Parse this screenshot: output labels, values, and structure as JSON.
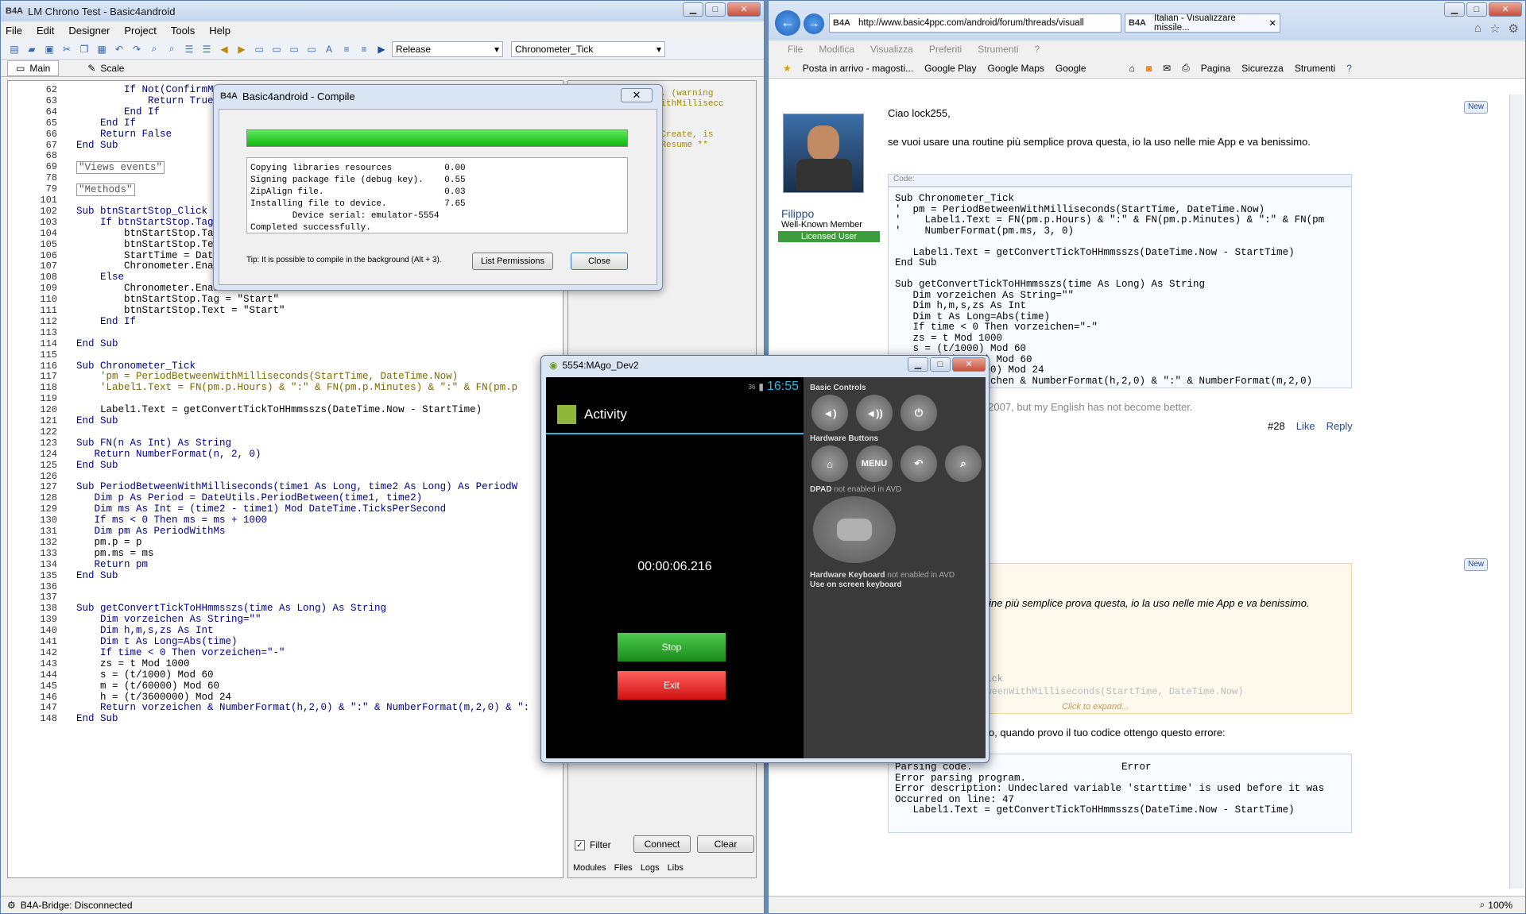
{
  "ide": {
    "title": "LM Chrono Test - Basic4android",
    "menu": [
      "File",
      "Edit",
      "Designer",
      "Project",
      "Tools",
      "Help"
    ],
    "build_config": "Release",
    "sub_selector": "Chronometer_Tick",
    "tabs": [
      "Main",
      "Scale"
    ],
    "status": "B4A-Bridge: Disconnected",
    "lines": [
      {
        "n": "62",
        "t": "        If Not(ConfirmM"
      },
      {
        "n": "63",
        "t": "            Return True"
      },
      {
        "n": "64",
        "t": "        End If"
      },
      {
        "n": "65",
        "t": "    End If"
      },
      {
        "n": "66",
        "t": "    Return False"
      },
      {
        "n": "67",
        "t": "End Sub"
      },
      {
        "n": "68",
        "t": ""
      },
      {
        "n": "69",
        "t": "\"Views events\""
      },
      {
        "n": "78",
        "t": ""
      },
      {
        "n": "79",
        "t": "\"Methods\""
      },
      {
        "n": "101",
        "t": ""
      },
      {
        "n": "102",
        "t": "Sub btnStartStop_Click"
      },
      {
        "n": "103",
        "t": "    If btnStartStop.Tag"
      },
      {
        "n": "104",
        "t": "        btnStartStop.Ta"
      },
      {
        "n": "105",
        "t": "        btnStartStop.Te"
      },
      {
        "n": "106",
        "t": "        StartTime = DateTime.Now"
      },
      {
        "n": "107",
        "t": "        Chronometer.Enabled = True"
      },
      {
        "n": "108",
        "t": "    Else"
      },
      {
        "n": "109",
        "t": "        Chronometer.Enabled = False"
      },
      {
        "n": "110",
        "t": "        btnStartStop.Tag = \"Start\""
      },
      {
        "n": "111",
        "t": "        btnStartStop.Text = \"Start\""
      },
      {
        "n": "112",
        "t": "    End If"
      },
      {
        "n": "113",
        "t": ""
      },
      {
        "n": "114",
        "t": "End Sub"
      },
      {
        "n": "115",
        "t": ""
      },
      {
        "n": "116",
        "t": "Sub Chronometer_Tick"
      },
      {
        "n": "117",
        "t": "    'pm = PeriodBetweenWithMilliseconds(StartTime, DateTime.Now)"
      },
      {
        "n": "118",
        "t": "    'Label1.Text = FN(pm.p.Hours) & \":\" & FN(pm.p.Minutes) & \":\" & FN(pm.p"
      },
      {
        "n": "119",
        "t": ""
      },
      {
        "n": "120",
        "t": "    Label1.Text = getConvertTickToHHmmsszs(DateTime.Now - StartTime)"
      },
      {
        "n": "121",
        "t": "End Sub"
      },
      {
        "n": "122",
        "t": ""
      },
      {
        "n": "123",
        "t": "Sub FN(n As Int) As String"
      },
      {
        "n": "124",
        "t": "   Return NumberFormat(n, 2, 0)"
      },
      {
        "n": "125",
        "t": "End Sub"
      },
      {
        "n": "126",
        "t": ""
      },
      {
        "n": "127",
        "t": "Sub PeriodBetweenWithMilliseconds(time1 As Long, time2 As Long) As PeriodW"
      },
      {
        "n": "128",
        "t": "   Dim p As Period = DateUtils.PeriodBetween(time1, time2)"
      },
      {
        "n": "129",
        "t": "   Dim ms As Int = (time2 - time1) Mod DateTime.TicksPerSecond"
      },
      {
        "n": "130",
        "t": "   If ms < 0 Then ms = ms + 1000"
      },
      {
        "n": "131",
        "t": "   Dim pm As PeriodWithMs"
      },
      {
        "n": "132",
        "t": "   pm.p = p"
      },
      {
        "n": "133",
        "t": "   pm.ms = ms"
      },
      {
        "n": "134",
        "t": "   Return pm"
      },
      {
        "n": "135",
        "t": "End Sub"
      },
      {
        "n": "136",
        "t": ""
      },
      {
        "n": "137",
        "t": ""
      },
      {
        "n": "138",
        "t": "Sub getConvertTickToHHmmsszs(time As Long) As String"
      },
      {
        "n": "139",
        "t": "    Dim vorzeichen As String=\"\""
      },
      {
        "n": "140",
        "t": "    Dim h,m,s,zs As Int"
      },
      {
        "n": "141",
        "t": "    Dim t As Long=Abs(time)"
      },
      {
        "n": "142",
        "t": "    If time < 0 Then vorzeichen=\"-\""
      },
      {
        "n": "143",
        "t": "    zs = t Mod 1000"
      },
      {
        "n": "144",
        "t": "    s = (t/1000) Mod 60"
      },
      {
        "n": "145",
        "t": "    m = (t/60000) Mod 60"
      },
      {
        "n": "146",
        "t": "    h = (t/3600000) Mod 24"
      },
      {
        "n": "147",
        "t": "    Return vorzeichen & NumberFormat(h,2,0) & \":\" & NumberFormat(m,2,0) & \":"
      },
      {
        "n": "148",
        "t": "End Sub"
      }
    ],
    "log_lines": [
      "used. (warning",
      "eenWithMillisecc",
      "",
      "",
      "in) Create, is",
      "in) Resume **"
    ],
    "log_filter": "Filter",
    "log_connect": "Connect",
    "log_clear": "Clear",
    "bottom_tabs": [
      "Modules",
      "Files",
      "Logs",
      "Libs"
    ]
  },
  "compile": {
    "title": "Basic4android - Compile",
    "progress": 1.0,
    "log": [
      "Copying libraries resources          0.00",
      "Signing package file (debug key).    0.55",
      "ZipAlign file.                       0.03",
      "Installing file to device.           7.65",
      "        Device serial: emulator-5554",
      "Completed successfully."
    ],
    "tip": "Tip: It is possible to compile in the background (Alt + 3).",
    "list_permissions": "List Permissions",
    "close": "Close"
  },
  "emulator": {
    "title": "5554:MAgo_Dev2",
    "clock": "16:55",
    "signal": "36",
    "app_title": "Activity",
    "chrono": "00:00:06.216",
    "stop": "Stop",
    "exit": "Exit",
    "basic_controls": "Basic Controls",
    "hardware_buttons": "Hardware Buttons",
    "menu": "MENU",
    "dpad_label": "DPAD",
    "dpad_note": "not enabled in AVD",
    "hwkb_label": "Hardware Keyboard",
    "hwkb_note": "not enabled in AVD",
    "screen_kb": "Use on screen keyboard"
  },
  "browser": {
    "url": "http://www.basic4ppc.com/android/forum/threads/visuall",
    "tab": "Italian - Visualizzare missile...",
    "menu": [
      "File",
      "Modifica",
      "Visualizza",
      "Preferiti",
      "Strumenti",
      "?"
    ],
    "favorites": [
      "Posta in arrivo - magosti...",
      "Google Play",
      "Google Maps",
      "Google"
    ],
    "toolbar": [
      "Pagina",
      "Sicurezza",
      "Strumenti"
    ],
    "zoom": "100%",
    "user": "Filippo",
    "user_rank": "Well-Known Member",
    "user_badge": "Licensed User",
    "greeting": "Ciao lock255,",
    "post_text": "se vuoi usare una routine più semplice prova questa, io la uso nelle mie App e va benissimo.",
    "code_label": "Code:",
    "code1": [
      "Sub Chronometer_Tick",
      "'  pm = PeriodBetweenWithMilliseconds(StartTime, DateTime.Now)",
      "'    Label1.Text = FN(pm.p.Hours) & \":\" & FN(pm.p.Minutes) & \":\" & FN(pm",
      "'    NumberFormat(pm.ms, 3, 0)",
      "",
      "   Label1.Text = getConvertTickToHHmmsszs(DateTime.Now - StartTime)",
      "End Sub",
      "",
      "Sub getConvertTickToHHmmsszs(time As Long) As String",
      "   Dim vorzeichen As String=\"\"",
      "   Dim h,m,s,zs As Int",
      "   Dim t As Long=Abs(time)",
      "   If time < 0 Then vorzeichen=\"-\"",
      "   zs = t Mod 1000",
      "   s = (t/1000) Mod 60",
      "   m = (t/60000) Mod 60",
      "   h = (t/3600000) Mod 24",
      "   Return vorzeichen & NumberFormat(h,2,0) & \":\" & NumberFormat(m,2,0)"
    ],
    "signature": "May 2007, but my English has not become better.",
    "post_num": "#28",
    "like": "Like",
    "reply": "Reply",
    "new_badge": "New",
    "quote_text": "outine più semplice prova questa, io la uso nelle mie App e va benissimo.",
    "quote_code1": "_Tick",
    "quote_code2": "etweenWithMilliseconds(StartTime, DateTime.Now)",
    "click_expand": "Click to expand...",
    "reply_text": "mento, quando provo il tuo codice ottengo questo errore:",
    "code2": [
      "Parsing code.                         Error",
      "Error parsing program.",
      "Error description: Undeclared variable 'starttime' is used before it was",
      "Occurred on line: 47",
      "   Label1.Text = getConvertTickToHHmmsszs(DateTime.Now - StartTime)"
    ]
  }
}
